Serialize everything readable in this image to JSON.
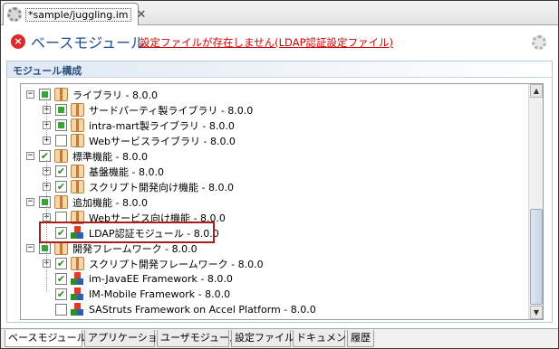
{
  "editor_tab": {
    "title": "*sample/juggling.im",
    "close": "✕"
  },
  "header": {
    "title": "ベースモジュール",
    "error_icon": "×",
    "error_message": "設定ファイルが存在しません(LDAP認証設定ファイル)"
  },
  "section": {
    "title": "モジュール構成"
  },
  "tree": {
    "nodes": [
      {
        "label": "ライブラリ - 8.0.0",
        "check": "partial",
        "icon": "package",
        "expander": "−"
      },
      {
        "label": "サードパーティ製ライブラリ - 8.0.0",
        "check": "partial",
        "icon": "package",
        "expander": "+"
      },
      {
        "label": "intra-mart製ライブラリ - 8.0.0",
        "check": "partial",
        "icon": "package",
        "expander": "+"
      },
      {
        "label": "Webサービスライブラリ - 8.0.0",
        "check": "none",
        "icon": "package",
        "expander": "+"
      },
      {
        "label": "標準機能 - 8.0.0",
        "check": "checked",
        "icon": "package",
        "expander": "−"
      },
      {
        "label": "基盤機能 - 8.0.0",
        "check": "checked",
        "icon": "package",
        "expander": "+"
      },
      {
        "label": "スクリプト開発向け機能 - 8.0.0",
        "check": "checked",
        "icon": "package",
        "expander": "+"
      },
      {
        "label": "追加機能 - 8.0.0",
        "check": "partial",
        "icon": "package",
        "expander": "−"
      },
      {
        "label": "Webサービス向け機能 - 8.0.0",
        "check": "none",
        "icon": "package",
        "expander": "+"
      },
      {
        "label": "LDAP認証モジュール - 8.0.0",
        "check": "checked",
        "icon": "module",
        "expander": ""
      },
      {
        "label": "開発フレームワーク - 8.0.0",
        "check": "partial",
        "icon": "package",
        "expander": "−"
      },
      {
        "label": "スクリプト開発フレームワーク - 8.0.0",
        "check": "checked",
        "icon": "package",
        "expander": "+"
      },
      {
        "label": "im-JavaEE Framework - 8.0.0",
        "check": "checked",
        "icon": "module",
        "expander": ""
      },
      {
        "label": "IM-Mobile Framework - 8.0.0",
        "check": "checked",
        "icon": "module",
        "expander": ""
      },
      {
        "label": "SAStruts Framework on Accel Platform - 8.0.0",
        "check": "none",
        "icon": "module",
        "expander": ""
      }
    ]
  },
  "scrollbar": {
    "up": "▲",
    "down": "▼"
  },
  "bottom_tabs": [
    "ベースモジュール",
    "アプリケーション",
    "ユーザモジュール",
    "設定ファイル",
    "ドキュメント",
    "履歴"
  ],
  "active_bottom_tab": "ベースモジュール",
  "colors": {
    "title": "#1f4f8a",
    "error": "#d00000",
    "highlight": "#a61e1e",
    "check": "#39a339"
  }
}
